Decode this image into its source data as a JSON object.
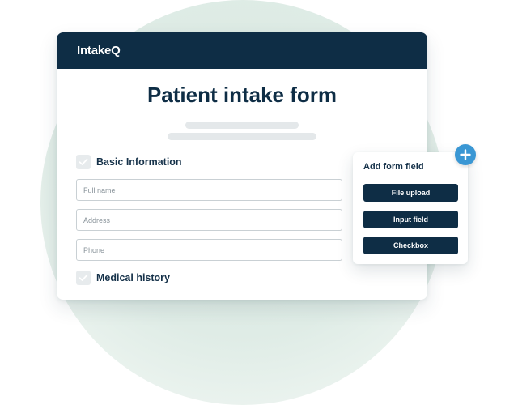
{
  "brand": {
    "logo_text": "IntakeQ",
    "header_color": "#0e2d45",
    "accent_color": "#3a97d4"
  },
  "form": {
    "title": "Patient intake form",
    "sections": [
      {
        "label": "Basic Information",
        "checked": true
      },
      {
        "label": "Medical history",
        "checked": true
      }
    ],
    "fields": [
      {
        "placeholder": "Full name"
      },
      {
        "placeholder": "Address"
      },
      {
        "placeholder": "Phone"
      }
    ]
  },
  "add_field_panel": {
    "title": "Add form field",
    "buttons": [
      {
        "label": "File upload"
      },
      {
        "label": "Input field"
      },
      {
        "label": "Checkbox"
      }
    ],
    "add_icon": "plus-icon"
  }
}
